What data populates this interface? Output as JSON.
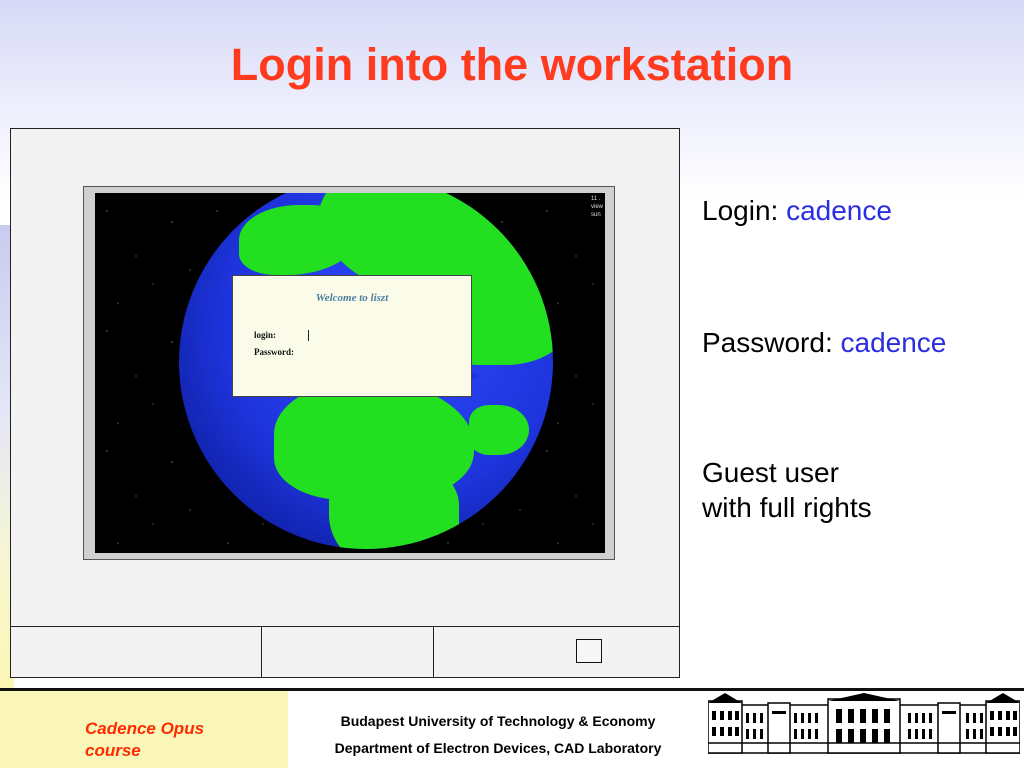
{
  "slide": {
    "title": "Login into the workstation"
  },
  "screen": {
    "corner_text": [
      "11 .",
      "view",
      "sun"
    ],
    "dialog": {
      "welcome": "Welcome to liszt",
      "login_label": "login:",
      "password_label": "Password:"
    }
  },
  "info": {
    "login_label": "Login:",
    "login_value": "cadence",
    "password_label": "Password:",
    "password_value": "cadence",
    "guest_line1": "Guest user",
    "guest_line2": "with full rights"
  },
  "footer": {
    "course_line1": "Cadence Opus",
    "course_line2": "course",
    "university": "Budapest University of Technology & Economy",
    "department": "Department of Electron Devices, CAD Laboratory"
  },
  "colors": {
    "title": "#ff3b1f",
    "value_text": "#2a2de0",
    "ocean": "#1e34dc",
    "land": "#22e01f",
    "footer_bg": "#fbf7b8"
  }
}
